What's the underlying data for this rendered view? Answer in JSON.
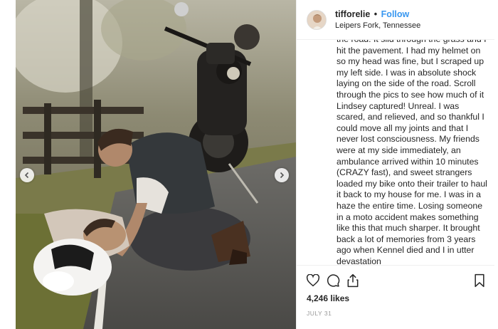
{
  "post": {
    "username": "tifforelie",
    "separator": "•",
    "follow_label": "Follow",
    "location": "Leipers Fork, Tennessee",
    "caption": "the road. It slid through the grass and I hit the pavement. I had my helmet on so my head was fine, but I scraped up my left side. I was in absolute shock laying on the side of the road. Scroll through the pics to see how much of it Lindsey captured! Unreal. I was scared, and relieved, and so thankful I could move all my joints and that I never lost consciousness. My friends were at my side immediately, an ambulance arrived within 10 minutes (CRAZY fast), and sweet strangers loaded my bike onto their trailer to haul it back to my house for me. I was in a haze the entire time. Losing someone in a moto accident makes something like this that much sharper. It brought back a lot of memories from 3 years ago when Kennel died and I in utter devastation",
    "likes": "4,246 likes",
    "date": "JULY 31"
  },
  "icons": {
    "like": "heart-icon",
    "comment": "comment-icon",
    "share": "share-icon",
    "save": "bookmark-icon",
    "prev": "chevron-left-icon",
    "next": "chevron-right-icon"
  },
  "colors": {
    "follow": "#3897f0",
    "text": "#262626",
    "muted": "#999999"
  }
}
